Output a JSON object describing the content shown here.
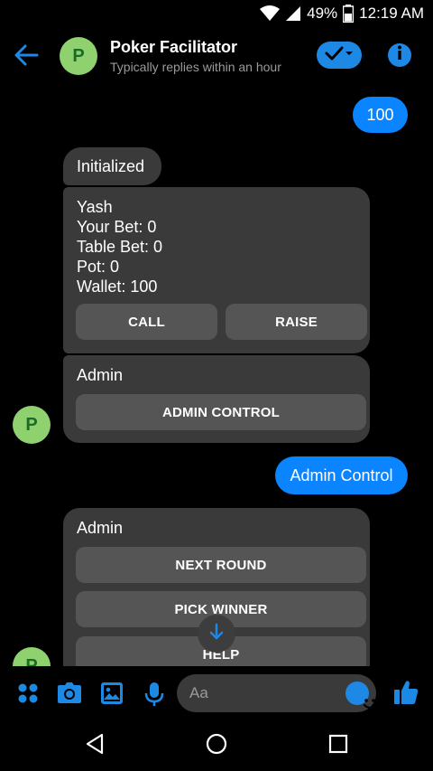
{
  "status": {
    "battery": "49%",
    "time": "12:19 AM"
  },
  "header": {
    "avatar_letter": "P",
    "title": "Poker Facilitator",
    "subtitle": "Typically replies within an hour"
  },
  "messages": {
    "sent_1": "100",
    "received_initialized": "Initialized",
    "game_card": {
      "lines": [
        "Yash",
        "Your Bet: 0",
        "Table Bet: 0",
        "Pot: 0",
        "Wallet: 100"
      ],
      "buttons": [
        "CALL",
        "RAISE"
      ]
    },
    "admin_card_1": {
      "title": "Admin",
      "button": "ADMIN CONTROL"
    },
    "sent_2": "Admin Control",
    "admin_card_2": {
      "title": "Admin",
      "buttons": [
        "NEXT ROUND",
        "PICK WINNER",
        "HELP"
      ]
    },
    "avatar_letter": "P"
  },
  "composer": {
    "placeholder": "Aa"
  },
  "colors": {
    "accent": "#1e88e5",
    "sent_bubble": "#0a84ff",
    "received_bubble": "#3a3a3a",
    "card_button": "#555555",
    "avatar": "#8fd16f"
  }
}
